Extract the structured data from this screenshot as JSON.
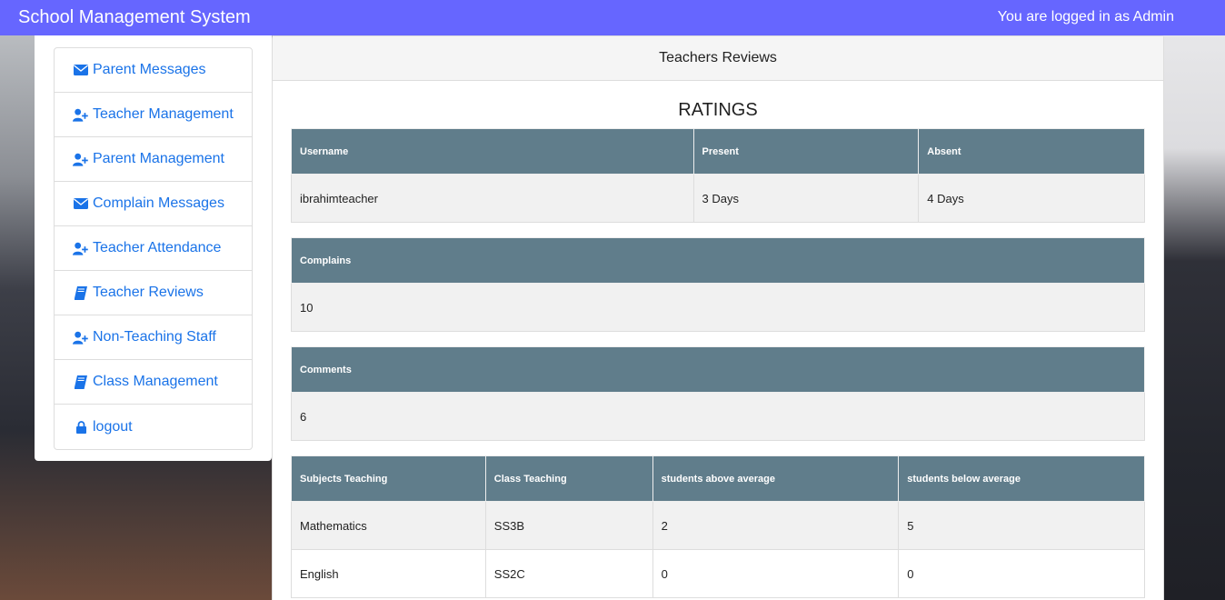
{
  "header": {
    "brand": "School Management System",
    "user_status": "You are logged in as Admin"
  },
  "sidebar": {
    "items": [
      {
        "label": "Parent Messages",
        "icon": "envelope-icon"
      },
      {
        "label": "Teacher Management",
        "icon": "user-plus-icon"
      },
      {
        "label": "Parent Management",
        "icon": "user-plus-icon"
      },
      {
        "label": "Complain Messages",
        "icon": "envelope-icon"
      },
      {
        "label": "Teacher Attendance",
        "icon": "user-plus-icon"
      },
      {
        "label": "Teacher Reviews",
        "icon": "book-icon"
      },
      {
        "label": "Non-Teaching Staff",
        "icon": "user-plus-icon"
      },
      {
        "label": "Class Management",
        "icon": "book-icon"
      },
      {
        "label": "logout",
        "icon": "lock-icon"
      }
    ]
  },
  "panel": {
    "title": "Teachers Reviews",
    "ratings_title": "RATINGS",
    "attendance": {
      "headers": [
        "Username",
        "Present",
        "Absent"
      ],
      "row": [
        "ibrahimteacher",
        "3 Days",
        "4 Days"
      ]
    },
    "complains": {
      "header": "Complains",
      "value": "10"
    },
    "comments": {
      "header": "Comments",
      "value": "6"
    },
    "subjects": {
      "headers": [
        "Subjects Teaching",
        "Class Teaching",
        "students above average",
        "students below average"
      ],
      "rows": [
        [
          "Mathematics",
          "SS3B",
          "2",
          "5"
        ],
        [
          "English",
          "SS2C",
          "0",
          "0"
        ]
      ]
    }
  },
  "colors": {
    "topbar": "#6666ff",
    "link": "#1a73e8",
    "table_header": "#607d8b"
  }
}
